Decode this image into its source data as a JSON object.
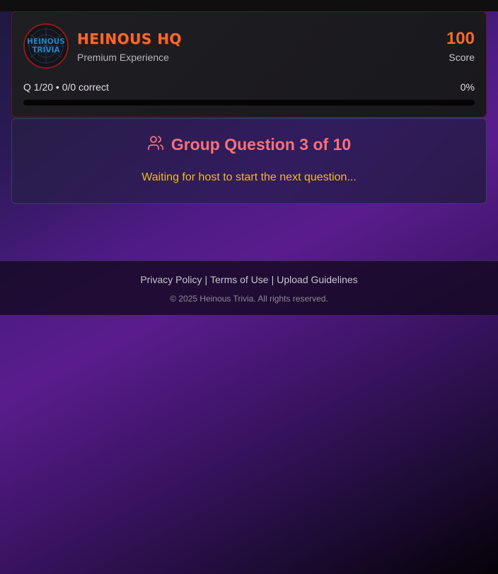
{
  "header": {
    "logo_text": [
      "HEINOUS",
      "TRIVIA"
    ],
    "title": "HEINOUS HQ",
    "subtitle": "Premium Experience",
    "score_value": "100",
    "score_label": "Score",
    "progress_text": "Q 1/20 • 0/0 correct",
    "progress_percent_text": "0%",
    "progress_fraction": 0
  },
  "question": {
    "icon": "users-icon",
    "title": "Group Question 3 of 10",
    "status": "Waiting for host to start the next question..."
  },
  "footer": {
    "links": [
      "Privacy Policy",
      "Terms of Use",
      "Upload Guidelines"
    ],
    "separator": "|",
    "copyright": "© 2025 Heinous Trivia. All rights reserved."
  },
  "colors": {
    "accent_orange": "#f26a2e",
    "question_title": "#f4727a",
    "status_yellow": "#f5b820",
    "logo_border": "#8b1a1a"
  }
}
